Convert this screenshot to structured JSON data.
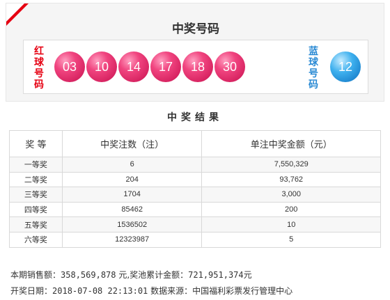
{
  "panel": {
    "title": "中奖号码",
    "red_label": [
      "红",
      "球",
      "号",
      "码"
    ],
    "blue_label": [
      "蓝",
      "球",
      "号",
      "码"
    ],
    "red_balls": [
      "03",
      "10",
      "14",
      "17",
      "18",
      "30"
    ],
    "blue_balls": [
      "12"
    ]
  },
  "results": {
    "title": "中奖结果",
    "headers": [
      "奖 等",
      "中奖注数（注）",
      "单注中奖金额（元）"
    ],
    "rows": [
      {
        "level": "一等奖",
        "count": "6",
        "amount": "7,550,329"
      },
      {
        "level": "二等奖",
        "count": "204",
        "amount": "93,762"
      },
      {
        "level": "三等奖",
        "count": "1704",
        "amount": "3,000"
      },
      {
        "level": "四等奖",
        "count": "85462",
        "amount": "200"
      },
      {
        "level": "五等奖",
        "count": "1536502",
        "amount": "10"
      },
      {
        "level": "六等奖",
        "count": "12323987",
        "amount": "5"
      }
    ]
  },
  "footer": {
    "sales_label": "本期销售额：",
    "sales_value": "358,569,878",
    "sales_unit": " 元,奖池累计金额：",
    "pool_value": "721,951,374",
    "pool_unit": "元",
    "date_label": "开奖日期：",
    "date_value": "2018-07-08 22:13:01",
    "source_label": " 数据来源：中国福利彩票发行管理中心"
  },
  "colors": {
    "accent_red": "#e60012",
    "blue_label": "#2a8ad4",
    "red_ball": "#f0447f",
    "blue_ball": "#3eb0ee"
  }
}
